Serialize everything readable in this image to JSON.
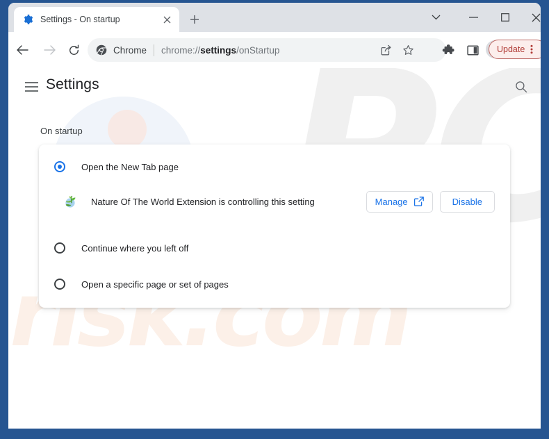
{
  "window": {
    "frame_color": "#265591",
    "controls": {
      "tab_search": "tab-search-chevron-down-icon",
      "minimize": "minimize-icon",
      "maximize": "maximize-icon",
      "close": "close-icon"
    }
  },
  "tab_strip": {
    "active_tab": {
      "title": "Settings - On startup",
      "favicon": "gear-icon",
      "close_icon": "close-icon"
    },
    "new_tab_label": "+"
  },
  "toolbar": {
    "back_icon": "arrow-left-icon",
    "forward_icon": "arrow-right-icon",
    "reload_icon": "reload-icon",
    "omnibox": {
      "brand_icon": "chrome-logo-icon",
      "brand_label": "Chrome",
      "url_prefix": "chrome://",
      "url_bold": "settings",
      "url_suffix": "/onStartup",
      "url_full": "chrome://settings/onStartup"
    },
    "share_icon": "share-icon",
    "bookmark_icon": "star-icon",
    "extensions_icon": "puzzle-piece-icon",
    "side_panel_icon": "side-panel-icon",
    "profile_icon": "person-avatar-icon",
    "update": {
      "label": "Update",
      "menu_icon": "three-dots-vertical-icon",
      "border_color": "#bd6a66",
      "text_color": "#b03a35",
      "background_color": "#fceeec"
    }
  },
  "settings": {
    "menu_icon": "hamburger-menu-icon",
    "title": "Settings",
    "search_icon": "search-icon",
    "section_label": "On startup",
    "options": [
      {
        "label": "Open the New Tab page",
        "selected": true
      },
      {
        "label": "Continue where you left off",
        "selected": false
      },
      {
        "label": "Open a specific page or set of pages",
        "selected": false
      }
    ],
    "extension_notice": {
      "icon": "nature-globe-sprout-extension-icon",
      "message": "Nature Of The World Extension is controlling this setting",
      "manage_label": "Manage",
      "manage_icon": "external-link-icon",
      "disable_label": "Disable",
      "link_color": "#1a73e8"
    },
    "selected_radio_color": "#1a73e8"
  },
  "watermark": {
    "logo_text": "PC",
    "domain_text": "risk.com"
  }
}
